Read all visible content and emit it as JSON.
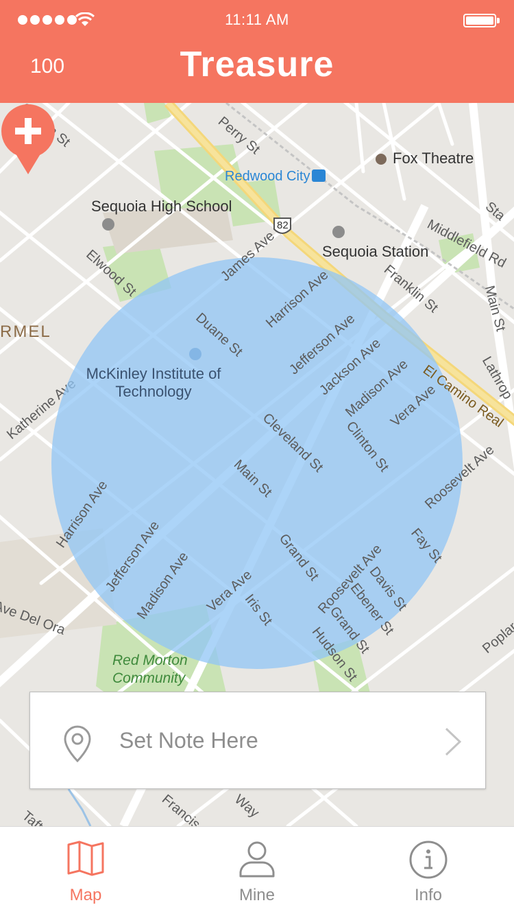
{
  "status": {
    "time": "11:11 AM"
  },
  "header": {
    "score": "100",
    "title": "Treasure"
  },
  "map": {
    "labels": {
      "perry": "Perry St",
      "fox": "Fox Theatre",
      "redwood": "Redwood City",
      "sequoia_high": "Sequoia High School",
      "hwy": "82",
      "sequoia_station": "Sequoia Station",
      "middlefield": "Middlefield Rd",
      "franklin": "Franklin St",
      "main": "Main St",
      "elwood": "Elwood St",
      "james": "James Ave",
      "harrison1": "Harrison Ave",
      "duane": "Duane St",
      "jefferson1": "Jefferson Ave",
      "jackson": "Jackson Ave",
      "madison1": "Madison Ave",
      "vera1": "Vera Ave",
      "el_camino": "El Camino Real",
      "rmel": "RMEL",
      "mckinley": "McKinley Institute of Technology",
      "katherine": "Katherine Ave",
      "cleveland": "Cleveland St",
      "clinton": "Clinton St",
      "roosevelt1": "Roosevelt Ave",
      "harrison2": "Harrison Ave",
      "jefferson2": "Jefferson Ave",
      "madison2": "Madison Ave",
      "vera2": "Vera Ave",
      "iris": "Iris St",
      "grand1": "Grand St",
      "roosevelt2": "Roosevelt Ave",
      "davis": "Davis St",
      "ebener": "Ebener St",
      "grand2": "Grand St",
      "hudson": "Hudson St",
      "fay": "Fay St",
      "del_ora": "Ave Del Ora",
      "red_morton": "Red Morton Community",
      "poplar": "Poplar",
      "lathrop": "Lathrop",
      "clinton_top": "Clinton St",
      "taft": "Taft",
      "way": "Way",
      "francis": "Francis",
      "main_st": "Main St",
      "stam": "Sta"
    }
  },
  "note": {
    "placeholder": "Set Note Here"
  },
  "tabs": [
    {
      "label": "Map",
      "active": true
    },
    {
      "label": "Mine",
      "active": false
    },
    {
      "label": "Info",
      "active": false
    }
  ],
  "colors": {
    "accent": "#f57560",
    "radius": "#90c6f5",
    "tab_inactive": "#8e8e8e"
  }
}
